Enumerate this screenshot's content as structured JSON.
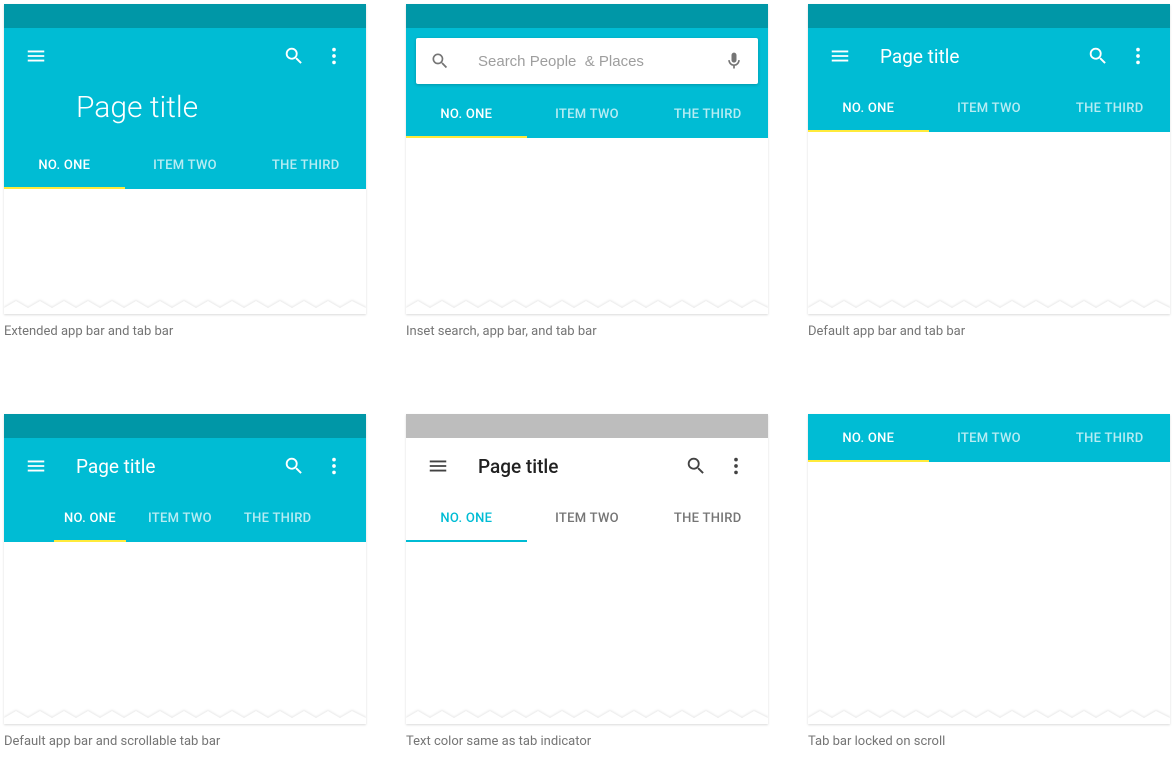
{
  "colors": {
    "primary": "#00bcd4",
    "primary_dark": "#0097a7",
    "accent": "#ffeb3b"
  },
  "common": {
    "page_title": "Page title",
    "tabs": [
      "NO. ONE",
      "ITEM TWO",
      "THE THIRD"
    ]
  },
  "panels": {
    "p1": {
      "caption": "Extended app bar and tab bar"
    },
    "p2": {
      "caption": "Inset search, app bar, and tab bar",
      "search_placeholder": "Search People  & Places"
    },
    "p3": {
      "caption": "Default app bar and tab bar"
    },
    "p4": {
      "caption": "Default app bar and scrollable tab bar"
    },
    "p5": {
      "caption": "Text color same as tab indicator"
    },
    "p6": {
      "caption": "Tab bar locked on scroll"
    }
  }
}
